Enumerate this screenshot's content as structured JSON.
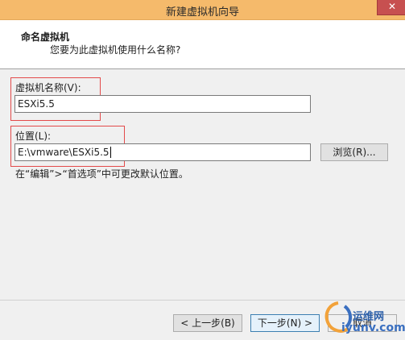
{
  "window": {
    "title": "新建虚拟机向导",
    "close_glyph": "✕"
  },
  "header": {
    "title": "命名虚拟机",
    "subtitle": "您要为此虚拟机使用什么名称?"
  },
  "vm_name": {
    "label": "虚拟机名称(V):",
    "value": "ESXi5.5"
  },
  "location": {
    "label": "位置(L):",
    "value": "E:\\vmware\\ESXi5.5",
    "browse_label": "浏览(R)..."
  },
  "hint": "在“编辑”>“首选项”中可更改默认位置。",
  "footer": {
    "back_label": "< 上一步(B)",
    "next_label": "下一步(N) >",
    "cancel_label": "取消"
  },
  "watermark": {
    "line1": "运维网",
    "line2": "iyunv.com"
  },
  "colors": {
    "titlebar": "#f5ba6b",
    "close": "#c75050",
    "highlight": "#e34a4a",
    "primary_border": "#3c7fb1"
  }
}
